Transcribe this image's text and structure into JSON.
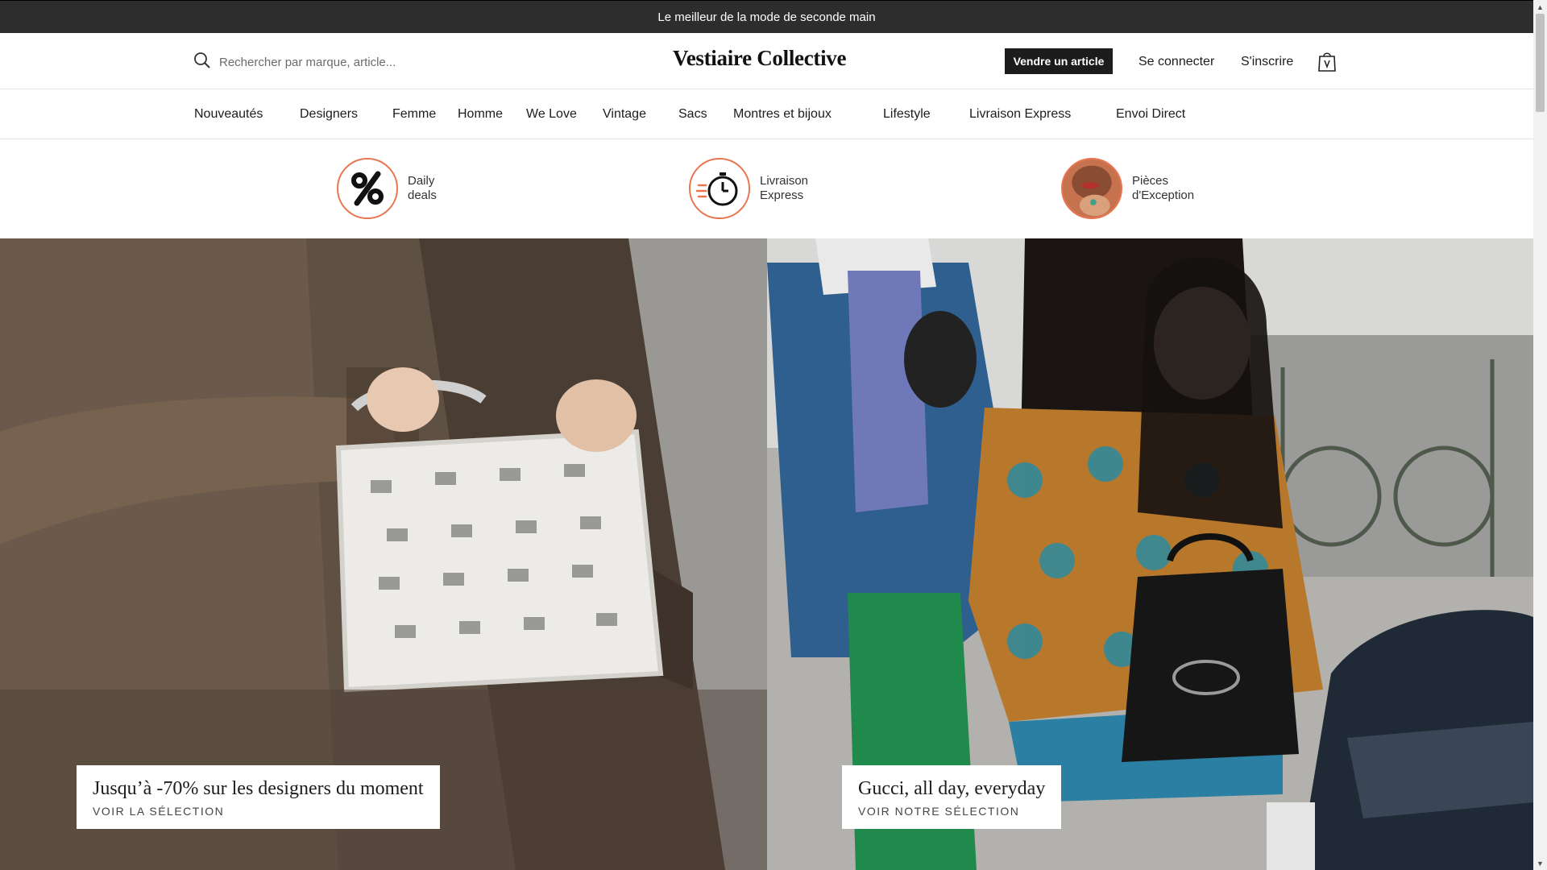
{
  "announcement": "Le meilleur de la mode de seconde main",
  "header": {
    "search_placeholder": "Rechercher par marque, article...",
    "logo": "Vestiaire Collective",
    "sell_label": "Vendre un article",
    "login_label": "Se connecter",
    "signup_label": "S'inscrire",
    "bag_icon": "shopping-bag-icon"
  },
  "nav": {
    "items": [
      "Nouveautés",
      "Designers",
      "Femme",
      "Homme",
      "We Love",
      "Vintage",
      "Sacs",
      "Montres et bijoux",
      "Lifestyle",
      "Livraison Express",
      "Envoi Direct"
    ]
  },
  "quick_links": [
    {
      "line1": "Daily",
      "line2": "deals",
      "icon": "percent-icon"
    },
    {
      "line1": "Livraison",
      "line2": "Express",
      "icon": "stopwatch-icon"
    },
    {
      "line1": "Pièces",
      "line2": "d'Exception",
      "icon": "portrait-image"
    }
  ],
  "heroes": [
    {
      "title": "Jusqu’à -70% sur les designers du moment",
      "cta": "VOIR LA SÉLECTION"
    },
    {
      "title": "Gucci, all day, everyday",
      "cta": "VOIR NOTRE SÉLECTION"
    }
  ],
  "colors": {
    "announcement_bg": "#2d2d2d",
    "accent_orange": "#e8754f",
    "button_bg": "#1c1c1c"
  }
}
